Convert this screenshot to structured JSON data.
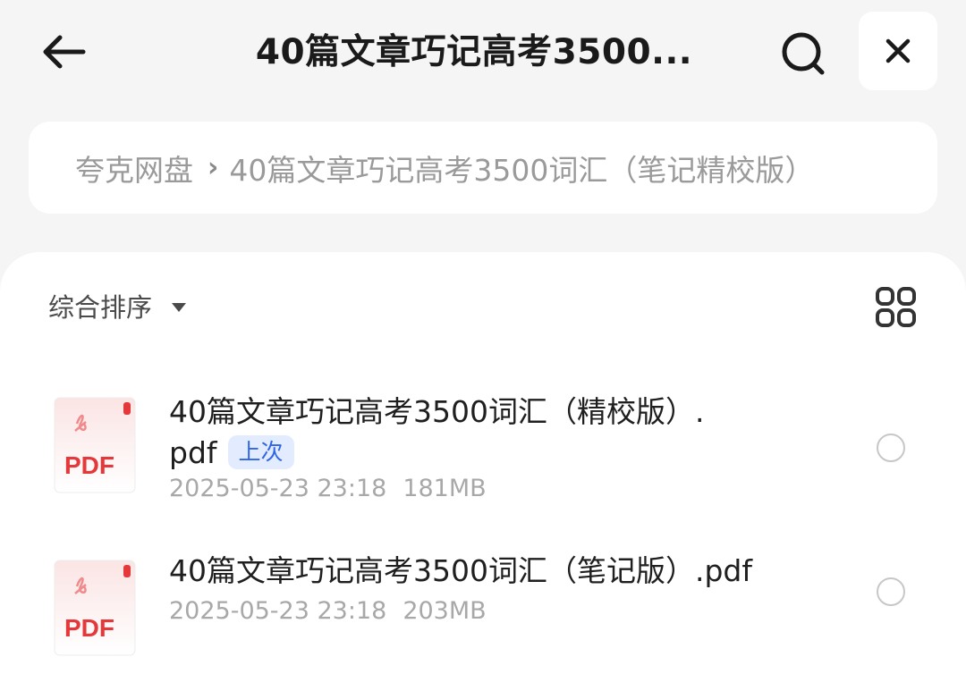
{
  "header": {
    "title": "40篇文章巧记高考3500...",
    "back_icon": "arrow-left-icon",
    "search_icon": "search-icon",
    "close_icon": "close-icon"
  },
  "breadcrumb": {
    "root": "夸克网盘",
    "separator": "›",
    "current": "40篇文章巧记高考3500词汇（笔记精校版）"
  },
  "toolbar": {
    "sort_label": "综合排序",
    "view_icon": "grid-view-icon"
  },
  "files": [
    {
      "name_line1": "40篇文章巧记高考3500词汇（精校版）.",
      "name_line2": "pdf",
      "badge": "上次",
      "date": "2025-05-23 23:18",
      "size": "181MB",
      "icon_label": "PDF"
    },
    {
      "name_line1": "40篇文章巧记高考3500词汇（笔记版）.pdf",
      "date": "2025-05-23 23:18",
      "size": "203MB",
      "icon_label": "PDF"
    }
  ],
  "colors": {
    "accent": "#2f66e6",
    "pdf_red": "#e5383b",
    "background": "#f5f5f5"
  }
}
